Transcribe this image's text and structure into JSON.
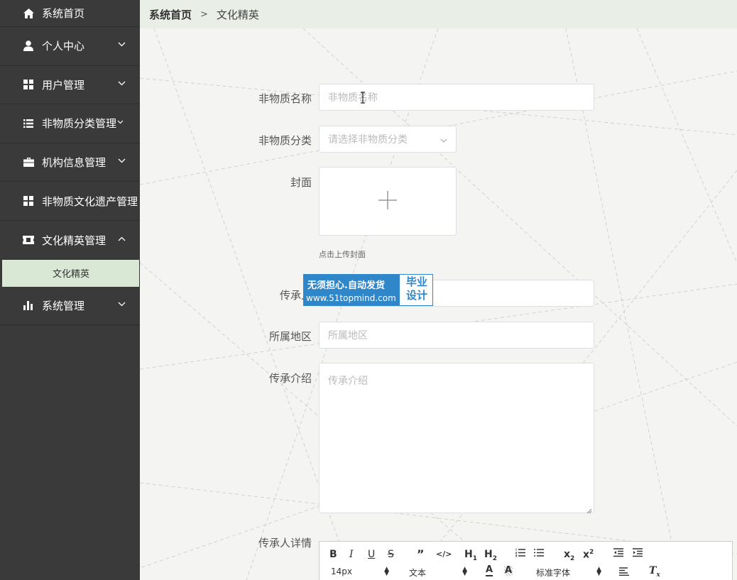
{
  "sidebar": {
    "items": [
      {
        "label": "系统首页",
        "icon": "home-icon"
      },
      {
        "label": "个人中心",
        "icon": "user-icon"
      },
      {
        "label": "用户管理",
        "icon": "grid-icon"
      },
      {
        "label": "非物质分类管理",
        "icon": "list-icon"
      },
      {
        "label": "机构信息管理",
        "icon": "briefcase-icon"
      },
      {
        "label": "非物质文化遗产管理",
        "icon": "grid-icon"
      },
      {
        "label": "文化精英管理",
        "icon": "ticket-icon"
      },
      {
        "label": "系统管理",
        "icon": "bar-chart-icon"
      }
    ],
    "sub_item": "文化精英"
  },
  "breadcrumb": {
    "home": "系统首页",
    "separator": ">",
    "current": "文化精英"
  },
  "form": {
    "name_label": "非物质名称",
    "name_placeholder": "非物质名称",
    "category_label": "非物质分类",
    "category_placeholder": "请选择非物质分类",
    "cover_label": "封面",
    "cover_hint": "点击上传封面",
    "inheritor_label": "传承人",
    "region_label": "所属地区",
    "region_placeholder": "所属地区",
    "intro_label": "传承介绍",
    "intro_placeholder": "传承介绍",
    "detail_label": "传承人详情"
  },
  "editor": {
    "font_size": "14px",
    "block_type": "文本",
    "font_family": "标准字体"
  },
  "watermark": {
    "line1": "无须担心.自动发货",
    "line2": "www.51topmind.com",
    "right_line1": "毕业",
    "right_line2": "设计"
  },
  "colors": {
    "sidebar_bg": "#3a3a3a",
    "active_sub_bg": "#d8e8d4",
    "header_bg": "#e9efe7",
    "watermark_blue": "#2f86c9"
  }
}
